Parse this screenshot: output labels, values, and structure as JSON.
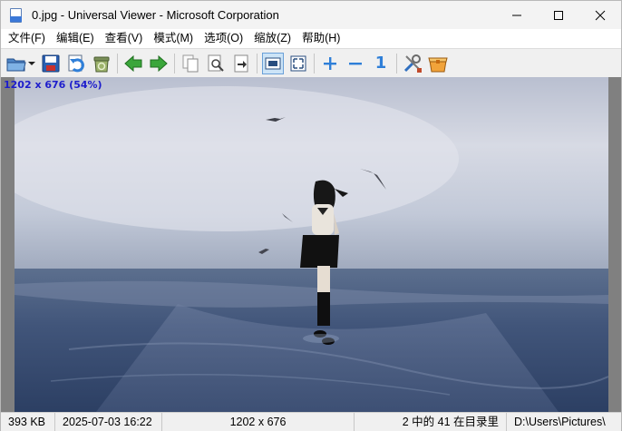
{
  "window": {
    "title": "0.jpg - Universal Viewer - Microsoft Corporation"
  },
  "menu": {
    "items": [
      {
        "label": "文件(F)",
        "name": "menu-file"
      },
      {
        "label": "编辑(E)",
        "name": "menu-edit"
      },
      {
        "label": "查看(V)",
        "name": "menu-view"
      },
      {
        "label": "模式(M)",
        "name": "menu-mode"
      },
      {
        "label": "选项(O)",
        "name": "menu-options"
      },
      {
        "label": "缩放(Z)",
        "name": "menu-zoom"
      },
      {
        "label": "帮助(H)",
        "name": "menu-help"
      }
    ]
  },
  "toolbar": {
    "icons": [
      "open-folder-icon",
      "dropdown-arrow-icon",
      "save-icon",
      "reload-icon",
      "recycle-bin-icon",
      "previous-arrow-icon",
      "next-arrow-icon",
      "copy-icon",
      "find-icon",
      "goto-icon",
      "fit-window-icon",
      "fullscreen-icon",
      "zoom-in-icon",
      "zoom-out-icon",
      "original-size-icon",
      "settings-tools-icon",
      "plugins-box-icon"
    ],
    "original_size_label": "1"
  },
  "viewer": {
    "image_info": "1202 x 676 (54%)"
  },
  "statusbar": {
    "file_size": "393 KB",
    "date": "2025-07-03 16:22",
    "dimensions": "1202 x 676",
    "count": "2 中的 41 在目录里",
    "path": "D:\\Users\\Pictures\\"
  },
  "colors": {
    "info_text": "#1d1dcc",
    "toolbar_green": "#3aa63a",
    "toolbar_blue": "#2f7fd8",
    "viewer_bg": "#808080"
  }
}
